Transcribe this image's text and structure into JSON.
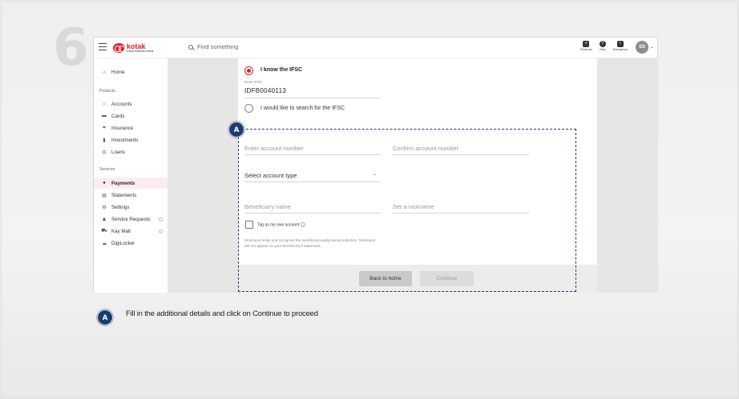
{
  "step": {
    "number": "6"
  },
  "topbar": {
    "logo_name": "kotak",
    "logo_sub": "Kotak Mahindra Bank",
    "search_placeholder": "Find something",
    "actions": [
      {
        "label": "Shortcuts",
        "icon": "shortcuts-icon",
        "glyph": "+"
      },
      {
        "label": "Help",
        "icon": "help-icon",
        "glyph": "?"
      },
      {
        "label": "Emergency",
        "icon": "emergency-icon",
        "glyph": "!"
      }
    ],
    "avatar_initials": "SS"
  },
  "sidebar": {
    "home": "Home",
    "products_heading": "Products",
    "products": [
      {
        "label": "Accounts",
        "icon": "bank-icon",
        "glyph": "⌂"
      },
      {
        "label": "Cards",
        "icon": "card-icon",
        "glyph": "▬"
      },
      {
        "label": "Insurance",
        "icon": "umbrella-icon",
        "glyph": "☂"
      },
      {
        "label": "Investments",
        "icon": "chart-icon",
        "glyph": "▮"
      },
      {
        "label": "Loans",
        "icon": "loan-icon",
        "glyph": "⚖"
      }
    ],
    "services_heading": "Services",
    "services": [
      {
        "label": "Payments",
        "icon": "payments-icon",
        "glyph": "●",
        "active": true
      },
      {
        "label": "Statements",
        "icon": "statements-icon",
        "glyph": "▤"
      },
      {
        "label": "Settings",
        "icon": "settings-icon",
        "glyph": "⚙"
      },
      {
        "label": "Service Requests",
        "icon": "service-requests-icon",
        "glyph": "♟"
      },
      {
        "label": "Kay Mall",
        "icon": "cart-icon",
        "glyph": "⛟"
      },
      {
        "label": "DigiLocker",
        "icon": "digilocker-icon",
        "glyph": "☁"
      }
    ]
  },
  "form": {
    "option_know_ifsc": "I know the IFSC",
    "ifsc_label": "Enter IFSC",
    "ifsc_value": "IDFB0040113",
    "option_search_ifsc": "I would like to search for the IFSC",
    "account_number_placeholder": "Enter account number",
    "confirm_account_placeholder": "Confirm account number",
    "account_type_placeholder": "Select account type",
    "beneficiary_name_placeholder": "Beneficiary name",
    "nickname_placeholder": "Set a nickname",
    "tag_own_account": "Tag as my own account",
    "nickname_help": "Nickname helps you recognise the beneficiary easily during selection. Nickname will not appear on your beneficiary's statement."
  },
  "buttons": {
    "back": "Back to home",
    "continue": "Continue"
  },
  "callout": {
    "badge": "A",
    "instruction": "Fill in the additional details and click on Continue to proceed"
  },
  "colors": {
    "brand_red": "#e31e24",
    "callout_navy": "#1c3d6e"
  }
}
